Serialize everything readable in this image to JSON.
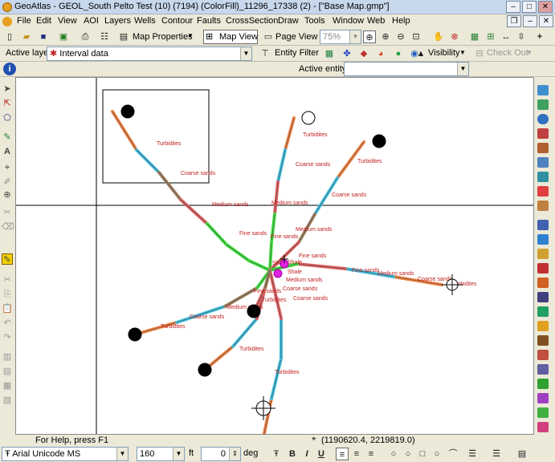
{
  "window": {
    "title": "GeoAtlas - GEOL_South Pelto Test (10) (7194) (ColorFill)_11296_17338 (2) - [\"Base Map.gmp\"]"
  },
  "menu": [
    "File",
    "Edit",
    "View",
    "AOI",
    "Layers",
    "Wells",
    "Contour",
    "Faults",
    "CrossSection",
    "Draw",
    "Tools",
    "Window",
    "Web",
    "Help"
  ],
  "toolbar1": {
    "map_properties": "Map Properties",
    "map_view": "Map View",
    "page_view": "Page View",
    "zoom": "75%"
  },
  "toolbar2": {
    "active_layer_label": "Active layer",
    "active_layer_value": "Interval data",
    "entity_filter": "Entity Filter",
    "visibility": "Visibility",
    "check_out": "Check Out"
  },
  "toolbar3": {
    "active_entity_label": "Active entity",
    "active_entity_value": ""
  },
  "status": {
    "help": "For Help, press F1",
    "coords": "(1190620.4, 2219819.0)"
  },
  "bottombar": {
    "font": "Arial Unicode MS",
    "size": "160",
    "size_unit": "ft",
    "angle": "0",
    "angle_unit": "deg"
  },
  "map_labels": [
    {
      "id": "l1",
      "text": "Turbidites"
    },
    {
      "id": "l2",
      "text": "Coarse sands"
    },
    {
      "id": "l3",
      "text": "Medium sands"
    },
    {
      "id": "l4",
      "text": "Fine sands"
    },
    {
      "id": "l5",
      "text": "Turbidites"
    },
    {
      "id": "l6",
      "text": "Coarse sands"
    },
    {
      "id": "l7",
      "text": "Medium sands"
    },
    {
      "id": "l8",
      "text": "Fine sands"
    },
    {
      "id": "l9",
      "text": "Turbidites"
    },
    {
      "id": "l10",
      "text": "Coarse sands"
    },
    {
      "id": "l11",
      "text": "Medium sands"
    },
    {
      "id": "l12",
      "text": "Fine sands"
    },
    {
      "id": "l13",
      "text": "Fine sands"
    },
    {
      "id": "l14",
      "text": "Medium sands"
    },
    {
      "id": "l15",
      "text": "Coarse sands"
    },
    {
      "id": "l16",
      "text": "Turbidites"
    },
    {
      "id": "l17",
      "text": "Shale"
    },
    {
      "id": "l18",
      "text": "Shale"
    },
    {
      "id": "l19",
      "text": "Shale"
    },
    {
      "id": "l20",
      "text": "Medium sands"
    },
    {
      "id": "l21",
      "text": "Coarse sands"
    },
    {
      "id": "l22",
      "text": "Coarse sands"
    },
    {
      "id": "l23",
      "text": "Turbidites"
    },
    {
      "id": "l24",
      "text": "Fine sands"
    },
    {
      "id": "l25",
      "text": "Medium sands"
    },
    {
      "id": "l26",
      "text": "Coarse sands"
    },
    {
      "id": "l27",
      "text": "Turbidites"
    },
    {
      "id": "l28",
      "text": "Turbidites"
    },
    {
      "id": "l29",
      "text": "Turbidites"
    }
  ]
}
